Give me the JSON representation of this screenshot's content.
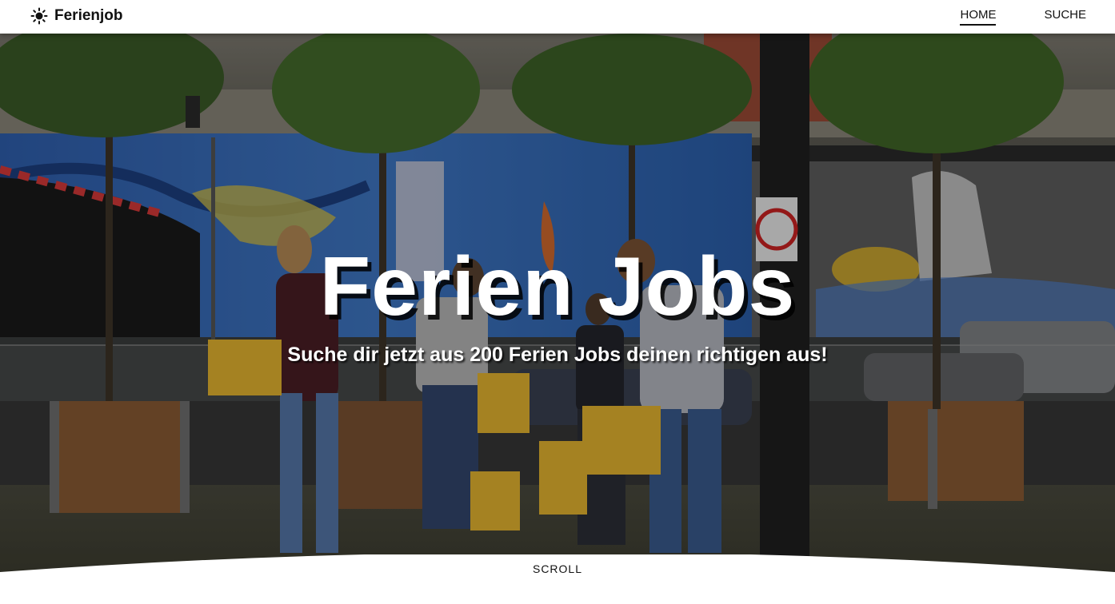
{
  "brand": {
    "name": "Ferienjob",
    "icon": "sun-icon"
  },
  "nav": {
    "items": [
      {
        "label": "HOME",
        "active": true
      },
      {
        "label": "SUCHE",
        "active": false
      }
    ]
  },
  "hero": {
    "title": "Ferien Jobs",
    "subtitle": "Suche dir jetzt aus 200 Ferien Jobs deinen richtigen aus!",
    "scroll_label": "SCROLL"
  },
  "colors": {
    "navbar_bg": "#ffffff",
    "text_dark": "#111111",
    "hero_text": "#ffffff"
  }
}
